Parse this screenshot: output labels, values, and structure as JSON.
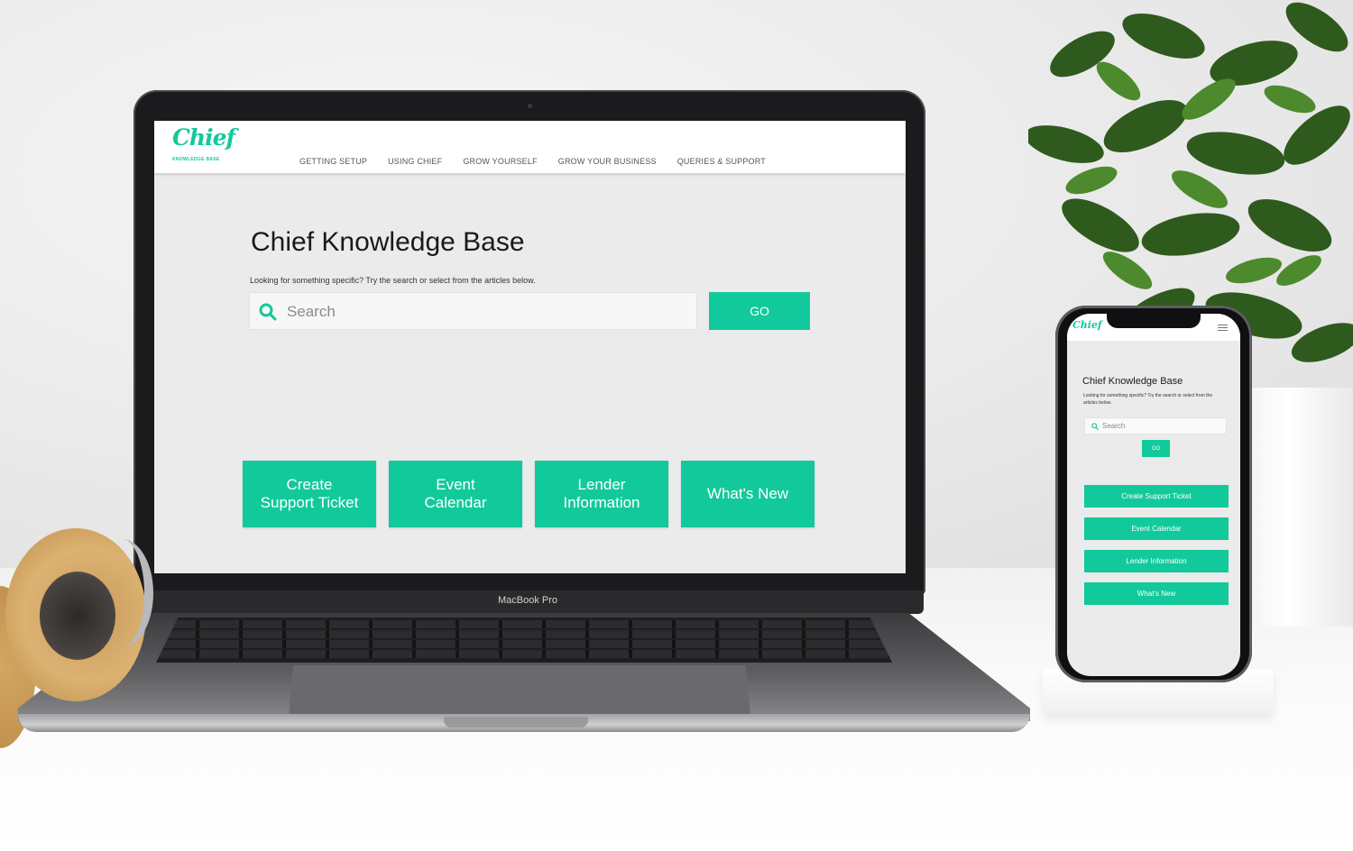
{
  "laptop": {
    "logo": {
      "script": "Chief",
      "subtitle": "KNOWLEDGE BASE"
    },
    "nav": [
      "GETTING SETUP",
      "USING CHIEF",
      "GROW YOURSELF",
      "GROW YOUR BUSINESS",
      "QUERIES & SUPPORT"
    ],
    "hero": {
      "title": "Chief Knowledge Base",
      "subtitle": "Looking for something specific? Try the search or select from the articles below."
    },
    "search": {
      "placeholder": "Search",
      "button": "GO"
    },
    "tiles": [
      "Create\nSupport Ticket",
      "Event\nCalendar",
      "Lender\nInformation",
      "What's New"
    ],
    "brand_label": "MacBook Pro"
  },
  "phone": {
    "logo": "Chief",
    "title": "Chief Knowledge Base",
    "subtitle": "Looking for something specific? Try the search or select from the articles below.",
    "search": {
      "placeholder": "Search",
      "button": "GO"
    },
    "tiles": [
      "Create Support Ticket",
      "Event Calendar",
      "Lender Information",
      "What's New"
    ]
  },
  "colors": {
    "accent": "#12c99b",
    "screen_bg": "#ebebeb"
  }
}
